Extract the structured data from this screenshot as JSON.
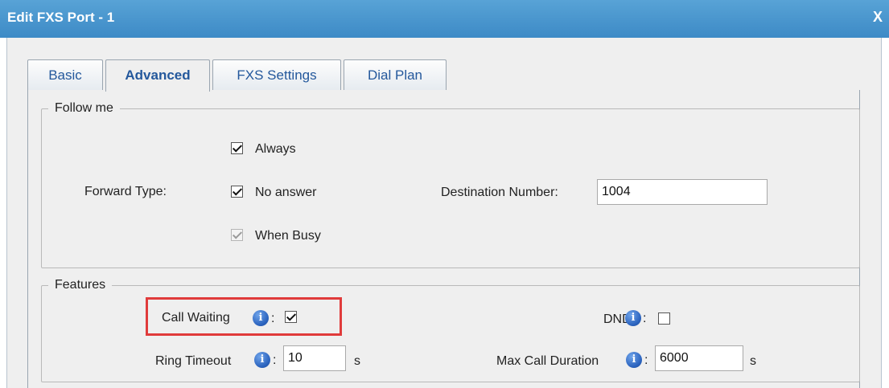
{
  "window": {
    "title": "Edit FXS Port - 1",
    "close_label": "X"
  },
  "tabs": [
    {
      "label": "Basic",
      "active": false
    },
    {
      "label": "Advanced",
      "active": true
    },
    {
      "label": "FXS Settings",
      "active": false
    },
    {
      "label": "Dial Plan",
      "active": false
    }
  ],
  "follow_me": {
    "legend": "Follow me",
    "forward_type_label": "Forward Type:",
    "options": [
      {
        "label": "Always",
        "checked": true,
        "disabled": false
      },
      {
        "label": "No answer",
        "checked": true,
        "disabled": false
      },
      {
        "label": "When Busy",
        "checked": true,
        "disabled": true
      }
    ],
    "destination_label": "Destination Number:",
    "destination_value": "1004"
  },
  "features": {
    "legend": "Features",
    "call_waiting": {
      "label": "Call Waiting",
      "colon": ":",
      "checked": true
    },
    "dnd": {
      "label": "DND",
      "colon": ":",
      "checked": false
    },
    "ring_timeout": {
      "label": "Ring Timeout",
      "colon": ":",
      "value": "10",
      "unit": "s"
    },
    "max_call_duration": {
      "label": "Max Call Duration",
      "colon": ":",
      "value": "6000",
      "unit": "s"
    }
  },
  "colors": {
    "titlebar": "#3d8ac6",
    "tab_text": "#24589c",
    "highlight": "#e03b3b",
    "info_icon": "#2c64bf"
  },
  "icons": {
    "info": "info-icon",
    "close": "close-icon"
  },
  "info_glyph": "i"
}
